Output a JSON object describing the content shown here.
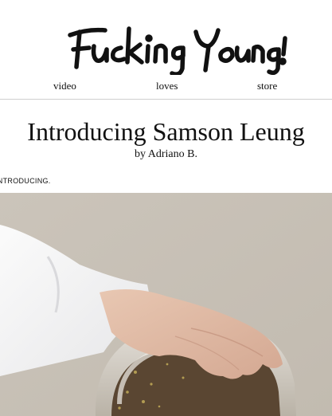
{
  "header": {
    "logo_text": "Fucking Young!"
  },
  "nav": {
    "items": [
      {
        "label": "video"
      },
      {
        "label": "loves"
      },
      {
        "label": "store"
      }
    ]
  },
  "article": {
    "title": "Introducing Samson Leung",
    "byline": "by Adriano B.",
    "category_crumb": "INTRODUCING."
  },
  "colors": {
    "background": "#ffffff",
    "text": "#111111",
    "photo_background": "#c9c2b7"
  },
  "icons": {
    "hero_image": "photo-hand-on-jar"
  }
}
